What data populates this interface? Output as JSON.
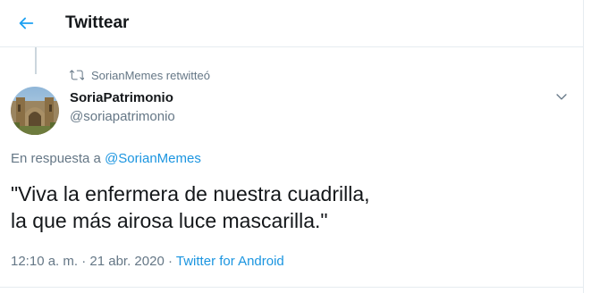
{
  "header": {
    "title": "Twittear",
    "back_icon": "back-arrow-icon"
  },
  "tweet": {
    "retweet_notice": "SorianMemes retwitteó",
    "retweet_icon": "retweet-icon",
    "author": {
      "name": "SoriaPatrimonio",
      "handle": "@soriapatrimonio"
    },
    "reply_prefix": "En respuesta a",
    "reply_mention": "@SorianMemes",
    "text_lines": [
      "\"Viva la enfermera de nuestra cuadrilla,",
      "la que más airosa luce mascarilla.\""
    ],
    "time": "12:10 a. m.",
    "separator": "·",
    "date": "21 abr. 2020",
    "source": "Twitter for Android",
    "menu_icon": "chevron-down-icon"
  },
  "colors": {
    "accent": "#1da1f2",
    "link": "#1b95e0",
    "text": "#14171a",
    "muted": "#657786",
    "border": "#e6ecf0"
  }
}
